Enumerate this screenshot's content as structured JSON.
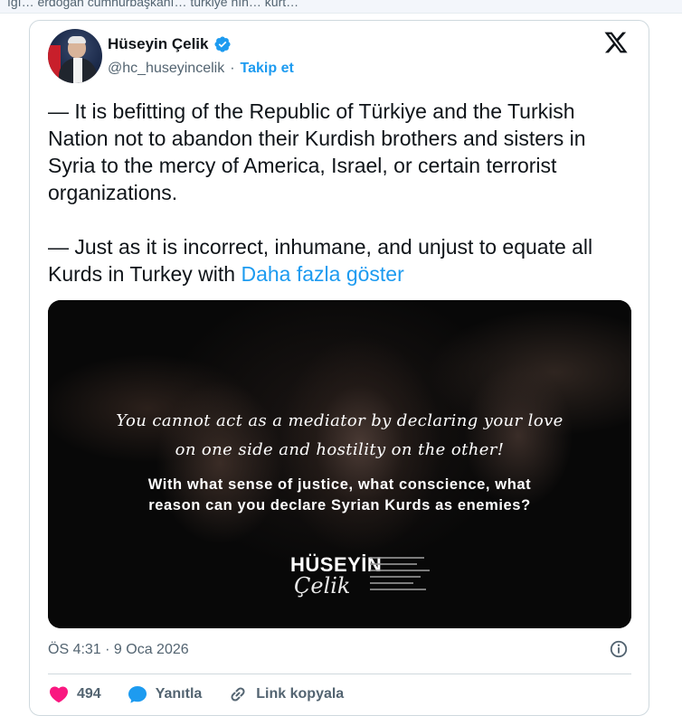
{
  "topbar": {
    "text": "ığı… erdoğan cumhurbaşkanı… türkiye nın… kürt…"
  },
  "author": {
    "name": "Hüseyin Çelik",
    "handle": "@hc_huseyincelik",
    "separator": "·",
    "follow_label": "Takip et"
  },
  "tweet": {
    "paragraph1": "— It is befitting of the Republic of Türkiye and the Turkish Nation not to abandon their Kurdish brothers and sisters in Syria to the mercy of America, Israel, or certain terrorist organizations.",
    "paragraph2": "— Just as it is incorrect, inhumane, and unjust to equate all Kurds in Turkey with",
    "show_more": "Daha fazla göster"
  },
  "media": {
    "quote_line1": "You cannot act as a mediator by declaring your love",
    "quote_line2": "on one side and hostility on the other!",
    "bold_line1": "With what sense of justice, what conscience, what",
    "bold_line2": "reason can you declare Syrian Kurds as enemies?",
    "signature_name": "HÜSEYİN",
    "signature_script": "Çelik"
  },
  "meta": {
    "timestamp": "ÖS 4:31 · 9 Oca 2026"
  },
  "actions": {
    "likes": "494",
    "reply_label": "Yanıtla",
    "copy_link_label": "Link kopyala"
  },
  "colors": {
    "accent": "#1d9bf0",
    "like": "#f91880",
    "muted": "#536471",
    "border": "#cfd9de"
  }
}
